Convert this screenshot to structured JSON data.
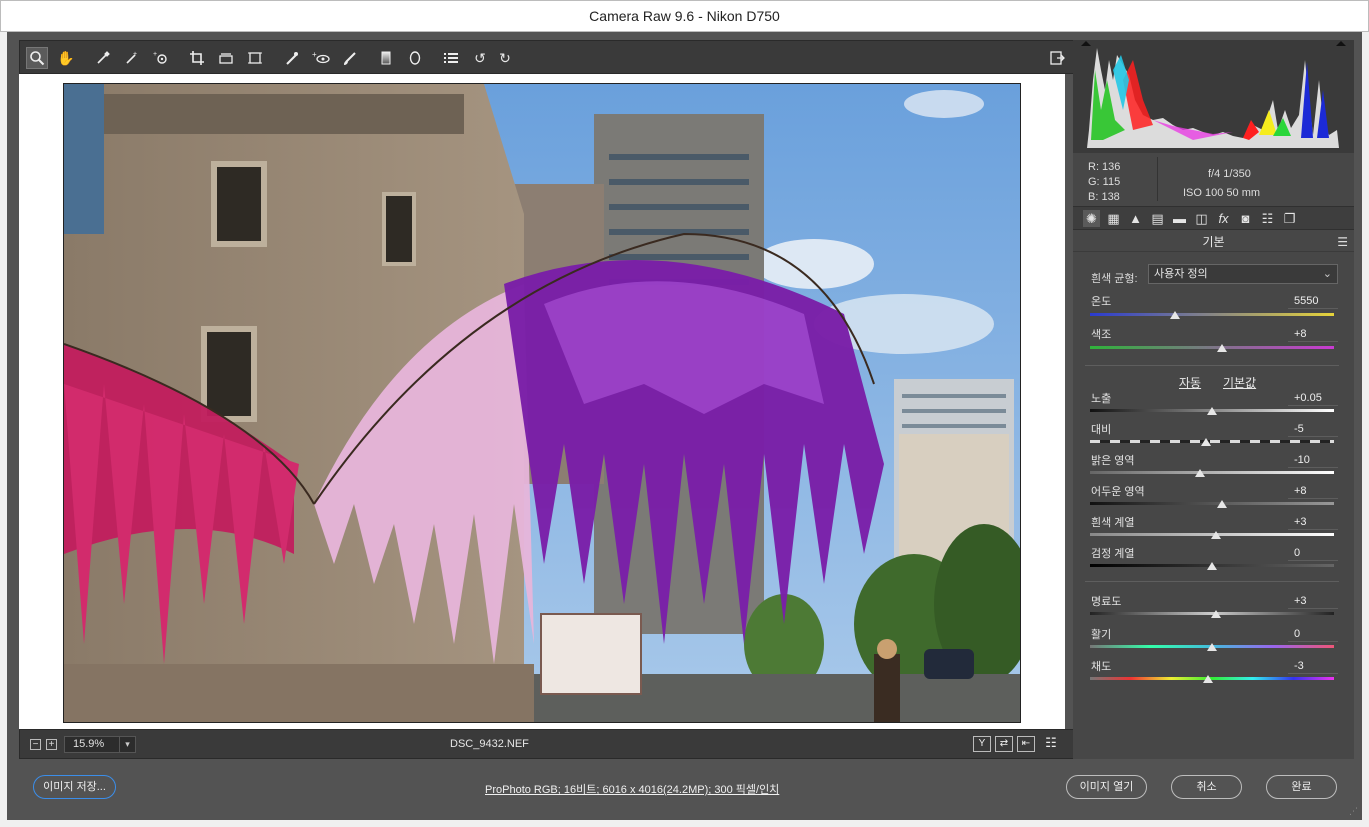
{
  "window": {
    "title": "Camera Raw 9.6  -  Nikon D750"
  },
  "toolbar": {
    "tools": [
      {
        "name": "zoom-tool",
        "glyph": "⚲"
      },
      {
        "name": "hand-tool",
        "glyph": "✋"
      },
      {
        "name": "white-balance-tool",
        "glyph": "✒"
      },
      {
        "name": "color-sampler-tool",
        "glyph": "✎"
      },
      {
        "name": "targeted-adjustment-tool",
        "glyph": "◎"
      },
      {
        "name": "crop-tool",
        "glyph": "⌐"
      },
      {
        "name": "straighten-tool",
        "glyph": "⊟"
      },
      {
        "name": "transform-tool",
        "glyph": "⊞"
      },
      {
        "name": "spot-removal-tool",
        "glyph": "✐"
      },
      {
        "name": "red-eye-tool",
        "glyph": "⊕"
      },
      {
        "name": "adjustment-brush-tool",
        "glyph": "✏"
      },
      {
        "name": "graduated-filter-tool",
        "glyph": "▮"
      },
      {
        "name": "radial-filter-tool",
        "glyph": "◯"
      },
      {
        "name": "preferences-tool",
        "glyph": "☰"
      },
      {
        "name": "rotate-left-tool",
        "glyph": "↺"
      },
      {
        "name": "rotate-right-tool",
        "glyph": "↻"
      }
    ],
    "fullscreen_icon": "⇱"
  },
  "preview": {
    "zoom": "15.9%",
    "filename": "DSC_9432.NEF"
  },
  "readout": {
    "r": "R:   136",
    "g": "G:   115",
    "b": "B:   138",
    "aperture_shutter": "f/4    1/350",
    "iso_focal": "ISO 100    50 mm"
  },
  "panel": {
    "title": "기본",
    "wb_label": "흰색 균형:",
    "wb_value": "사용자 정의",
    "auto_link": "자동",
    "default_link": "기본값",
    "sliders": [
      {
        "key": "temperature",
        "label": "온도",
        "value": "5550",
        "pos": 0.35
      },
      {
        "key": "tint",
        "label": "색조",
        "value": "+8",
        "pos": 0.54
      },
      {
        "key": "exposure",
        "label": "노출",
        "value": "+0.05",
        "pos": 0.5
      },
      {
        "key": "contrast",
        "label": "대비",
        "value": "-5",
        "pos": 0.475
      },
      {
        "key": "highlights",
        "label": "밝은 영역",
        "value": "-10",
        "pos": 0.45
      },
      {
        "key": "shadows",
        "label": "어두운 영역",
        "value": "+8",
        "pos": 0.54
      },
      {
        "key": "whites",
        "label": "흰색 계열",
        "value": "+3",
        "pos": 0.515
      },
      {
        "key": "blacks",
        "label": "검정 계열",
        "value": "0",
        "pos": 0.5
      },
      {
        "key": "clarity",
        "label": "명료도",
        "value": "+3",
        "pos": 0.515
      },
      {
        "key": "vibrance",
        "label": "활기",
        "value": "0",
        "pos": 0.5
      },
      {
        "key": "saturation",
        "label": "채도",
        "value": "-3",
        "pos": 0.485
      }
    ]
  },
  "bottom": {
    "save_button": "이미지 저장...",
    "info_link": "ProPhoto RGB; 16비트; 6016 x 4016(24.2MP); 300 픽셀/인치",
    "open_button": "이미지 열기",
    "cancel_button": "취소",
    "done_button": "완료"
  }
}
